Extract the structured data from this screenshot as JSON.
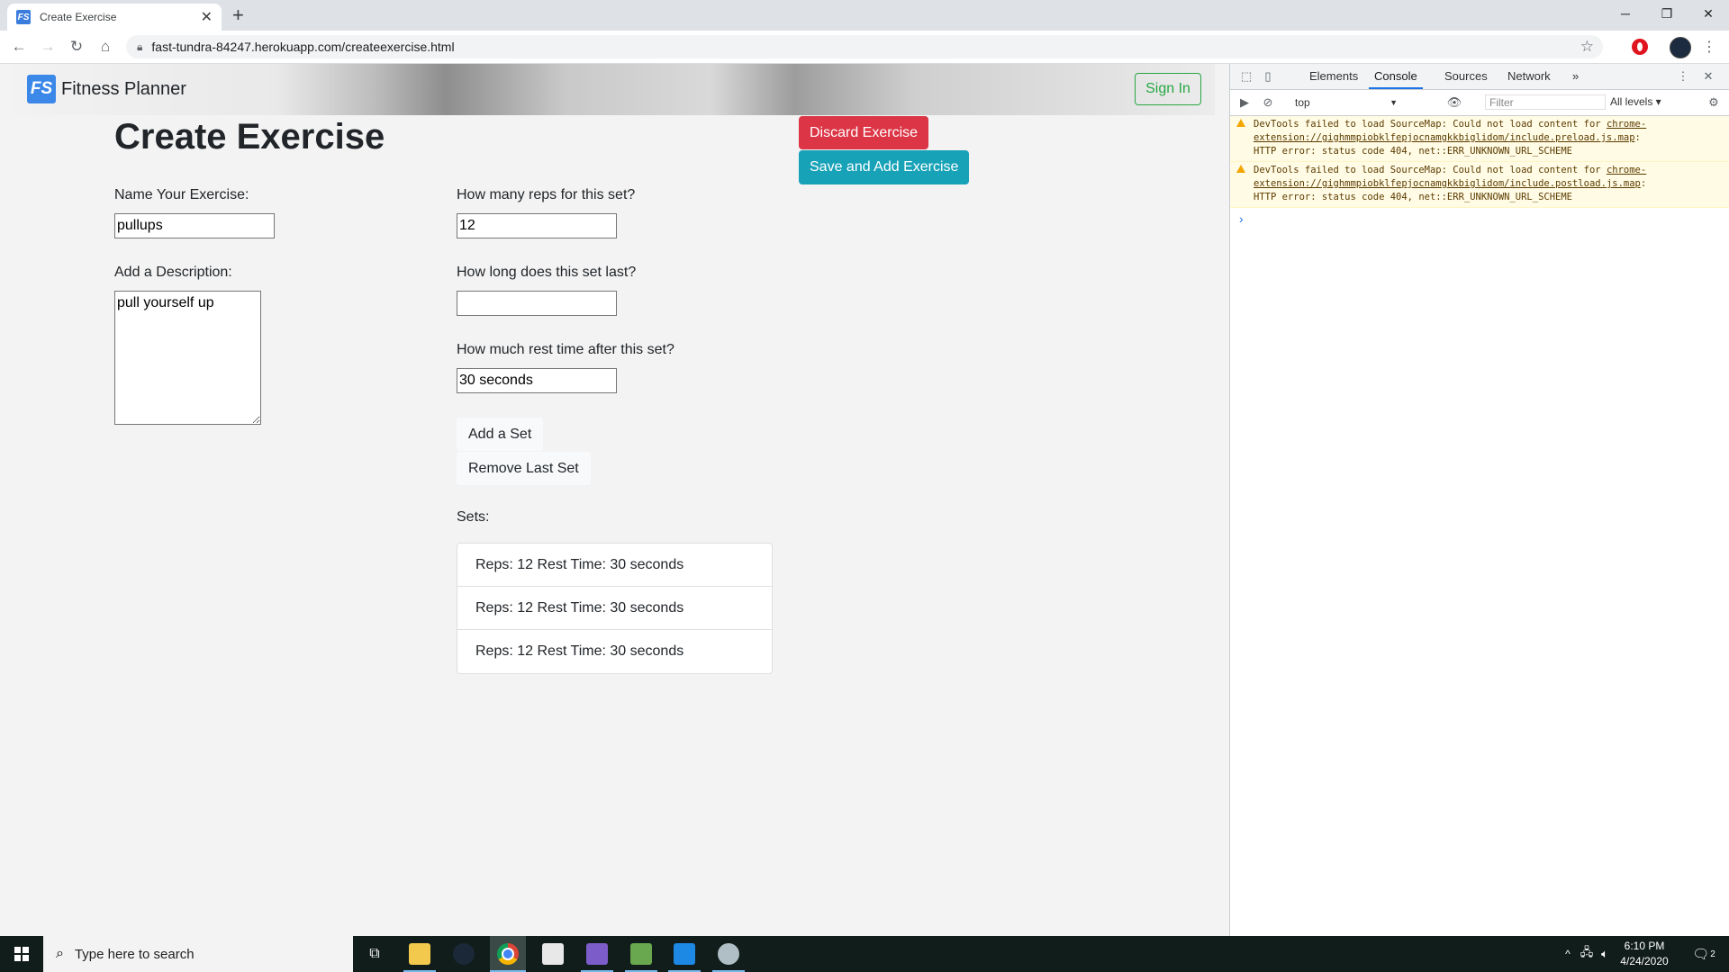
{
  "browser": {
    "tab_title": "Create Exercise",
    "tab_favicon": "FS",
    "url": "fast-tundra-84247.herokuapp.com/createexercise.html"
  },
  "site": {
    "brand_logo": "FS",
    "brand_name": "Fitness Planner",
    "sign_in_label": "Sign In"
  },
  "page": {
    "title": "Create Exercise",
    "discard_label": "Discard Exercise",
    "save_label": "Save and Add Exercise",
    "name_label": "Name Your Exercise:",
    "name_value": "pullups",
    "description_label": "Add a Description:",
    "description_value": "pull yourself up",
    "reps_label": "How many reps for this set?",
    "reps_value": "12",
    "duration_label": "How long does this set last?",
    "duration_value": "",
    "rest_label": "How much rest time after this set?",
    "rest_value": "30 seconds",
    "add_set_label": "Add a Set",
    "remove_set_label": "Remove Last Set",
    "sets_label": "Sets:",
    "sets": [
      "Reps: 12 Rest Time: 30 seconds",
      "Reps: 12 Rest Time: 30 seconds",
      "Reps: 12 Rest Time: 30 seconds"
    ]
  },
  "devtools": {
    "tabs": [
      "Elements",
      "Console",
      "Sources",
      "Network"
    ],
    "more": "»",
    "active_tab": "Console",
    "context": "top",
    "filter_placeholder": "Filter",
    "levels": "All levels ▾",
    "messages": [
      {
        "line1_text": "DevTools failed to load SourceMap: Could not load content for ",
        "line1_link": "chrome-",
        "line2_link": "extension://gighmmpiobklfepjocnamgkkbiglidom/include.preload.js.map",
        "line2_tail": ":",
        "line3": "HTTP error: status code 404, net::ERR_UNKNOWN_URL_SCHEME"
      },
      {
        "line1_text": "DevTools failed to load SourceMap: Could not load content for ",
        "line1_link": "chrome-",
        "line2_link": "extension://gighmmpiobklfepjocnamgkkbiglidom/include.postload.js.map",
        "line2_tail": ":",
        "line3": "HTTP error: status code 404, net::ERR_UNKNOWN_URL_SCHEME"
      }
    ],
    "prompt": "›"
  },
  "taskbar": {
    "search_placeholder": "Type here to search",
    "time": "6:10 PM",
    "date": "4/24/2020",
    "notification_count": "2"
  },
  "colors": {
    "danger": "#dc3545",
    "info": "#17a2b8",
    "success": "#28a745",
    "taskbar": "#111d1a"
  }
}
